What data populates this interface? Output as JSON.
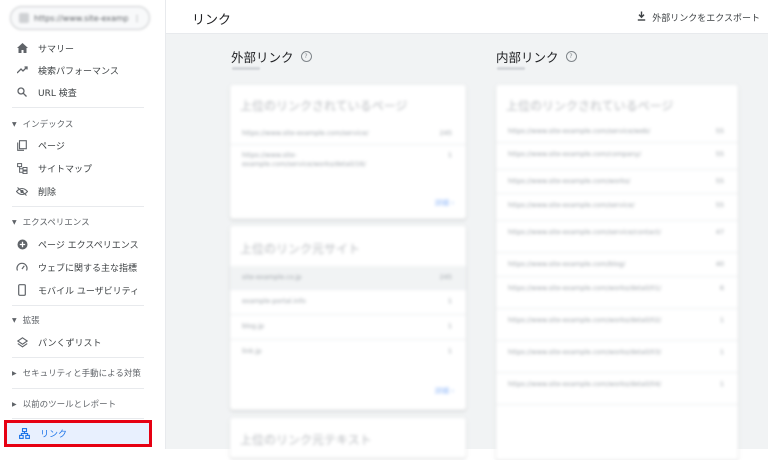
{
  "sidebar": {
    "property": {
      "url": "https://www.site-example.com/",
      "caret": "⋮"
    },
    "items": [
      {
        "label": "サマリー"
      },
      {
        "label": "検索パフォーマンス"
      },
      {
        "label": "URL 検査"
      }
    ],
    "sections": {
      "index": {
        "label": "インデックス",
        "items": [
          {
            "label": "ページ"
          },
          {
            "label": "サイトマップ"
          },
          {
            "label": "削除"
          }
        ]
      },
      "experience": {
        "label": "エクスペリエンス",
        "items": [
          {
            "label": "ページ エクスペリエンス"
          },
          {
            "label": "ウェブに関する主な指標"
          },
          {
            "label": "モバイル ユーザビリティ"
          }
        ]
      },
      "enhancements": {
        "label": "拡張",
        "items": [
          {
            "label": "パンくずリスト"
          }
        ]
      },
      "security": {
        "label": "セキュリティと手動による対策"
      },
      "legacy": {
        "label": "以前のツールとレポート"
      }
    },
    "links": {
      "label": "リンク"
    }
  },
  "header": {
    "title": "リンク",
    "export_label": "外部リンクをエクスポート"
  },
  "external": {
    "title": "外部リンク",
    "help": "?",
    "top_pages": {
      "title": "上位のリンクされているページ",
      "rows": [
        {
          "url": "https://www.site-example.com/service/",
          "count": "245"
        },
        {
          "url": "https://www.site-example.com/service/works/detail/16/",
          "count": "1"
        }
      ],
      "more": "詳細"
    },
    "top_sites": {
      "title": "上位のリンク元サイト",
      "rows": [
        {
          "url": "site-example.co.jp",
          "count": "245"
        },
        {
          "url": "example-portal.info",
          "count": "1"
        },
        {
          "url": "blog.jp",
          "count": "1"
        },
        {
          "url": "link.jp",
          "count": "1"
        }
      ],
      "more": "詳細"
    },
    "top_text": {
      "title": "上位のリンク元テキスト"
    }
  },
  "internal": {
    "title": "内部リンク",
    "help": "?",
    "top_pages": {
      "title": "上位のリンクされているページ",
      "rows": [
        {
          "url": "https://www.site-example.com/service/web/",
          "count": "55"
        },
        {
          "url": "https://www.site-example.com/company/",
          "count": "55"
        },
        {
          "url": "https://www.site-example.com/works/",
          "count": "55"
        },
        {
          "url": "https://www.site-example.com/service/",
          "count": "55"
        },
        {
          "url": "https://www.site-example.com/service/contact/",
          "count": "47"
        },
        {
          "url": "https://www.site-example.com/blog/",
          "count": "40"
        },
        {
          "url": "https://www.site-example.com/works/detail/01/",
          "count": "6"
        },
        {
          "url": "https://www.site-example.com/works/detail/02/",
          "count": "1"
        },
        {
          "url": "https://www.site-example.com/works/detail/03/",
          "count": "1"
        },
        {
          "url": "https://www.site-example.com/works/detail/04/",
          "count": "1"
        }
      ]
    }
  },
  "colors": {
    "accent": "#1a73e8",
    "highlight_border": "#e60012",
    "main_bg": "#f1f3f4"
  }
}
